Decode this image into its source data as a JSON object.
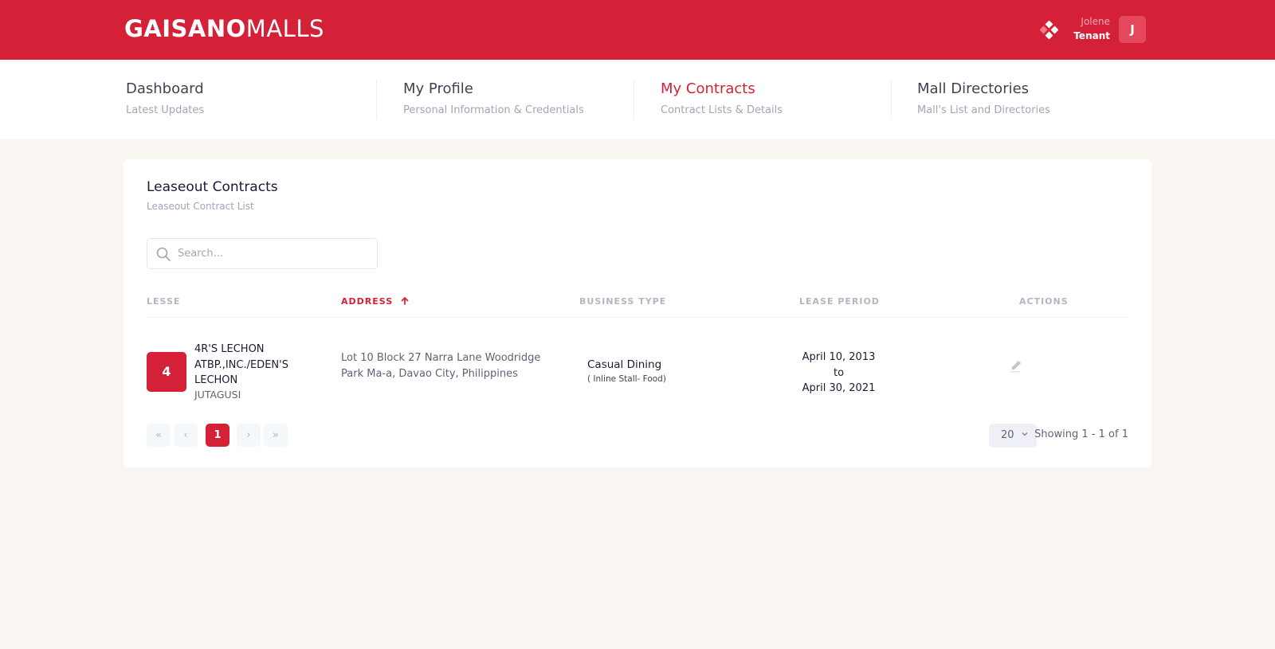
{
  "header": {
    "logo_bold": "GAISANO",
    "logo_light": "MALLS",
    "user_name": "Jolene",
    "user_role": "Tenant",
    "avatar_initial": "J",
    "brand_color": "#d42138",
    "menu_icon": "diamond-dots-icon"
  },
  "nav": {
    "items": [
      {
        "title": "Dashboard",
        "subtitle": "Latest Updates"
      },
      {
        "title": "My Profile",
        "subtitle": "Personal Information & Credentials"
      },
      {
        "title": "My Contracts",
        "subtitle": "Contract Lists & Details"
      },
      {
        "title": "Mall Directories",
        "subtitle": "Mall's List and Directories"
      }
    ],
    "active_index": 2
  },
  "card": {
    "title": "Leaseout Contracts",
    "subtitle": "Leaseout Contract List"
  },
  "search": {
    "placeholder": "Search...",
    "value": ""
  },
  "table": {
    "columns": [
      "LESSE",
      "ADDRESS",
      "BUSINESS TYPE",
      "LEASE PERIOD",
      "ACTIONS"
    ],
    "sorted_column": "ADDRESS",
    "sort_direction": "ascending",
    "rows": [
      {
        "badge": "4",
        "lesse_name": "4R'S LECHON ATBP.,INC./EDEN'S LECHON",
        "lesse_code": "JUTAGUSI",
        "address": "Lot 10 Block 27 Narra Lane Woodridge Park Ma-a, Davao City, Philippines",
        "business_type": "Casual Dining",
        "business_subtype": "( Inline Stall- Food)",
        "lease_start": "April 10, 2013",
        "lease_to": "to",
        "lease_end": "April 30, 2021",
        "action_icon": "pencil-edit-icon"
      }
    ]
  },
  "pagination": {
    "first": "«",
    "prev": "‹",
    "current_page": "1",
    "next": "›",
    "last": "»",
    "per_page": "20",
    "showing": "Showing 1 - 1 of 1"
  }
}
